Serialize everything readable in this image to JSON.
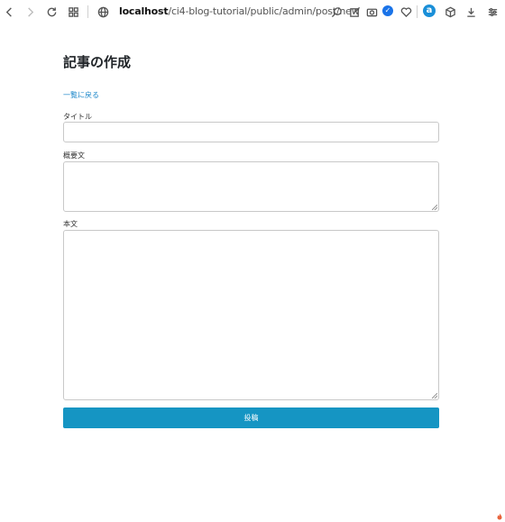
{
  "browser": {
    "url_host": "localhost",
    "url_path": "/ci4-blog-tutorial/public/admin/post/new",
    "amazon_label": "a",
    "icons": [
      "back-icon",
      "forward-icon",
      "reload-icon",
      "apps-icon",
      "globe-icon",
      "zoom-icon",
      "edit-icon",
      "camera-icon",
      "shield-icon",
      "heart-icon",
      "amazon-icon",
      "box-icon",
      "download-icon",
      "settings-icon"
    ]
  },
  "page": {
    "title": "記事の作成",
    "back_link": "一覧に戻る"
  },
  "form": {
    "title_label": "タイトル",
    "title_value": "",
    "summary_label": "概要文",
    "summary_value": "",
    "body_label": "本文",
    "body_value": "",
    "submit_label": "投稿"
  },
  "colors": {
    "accent": "#1595c3",
    "link": "#1a86c9"
  }
}
